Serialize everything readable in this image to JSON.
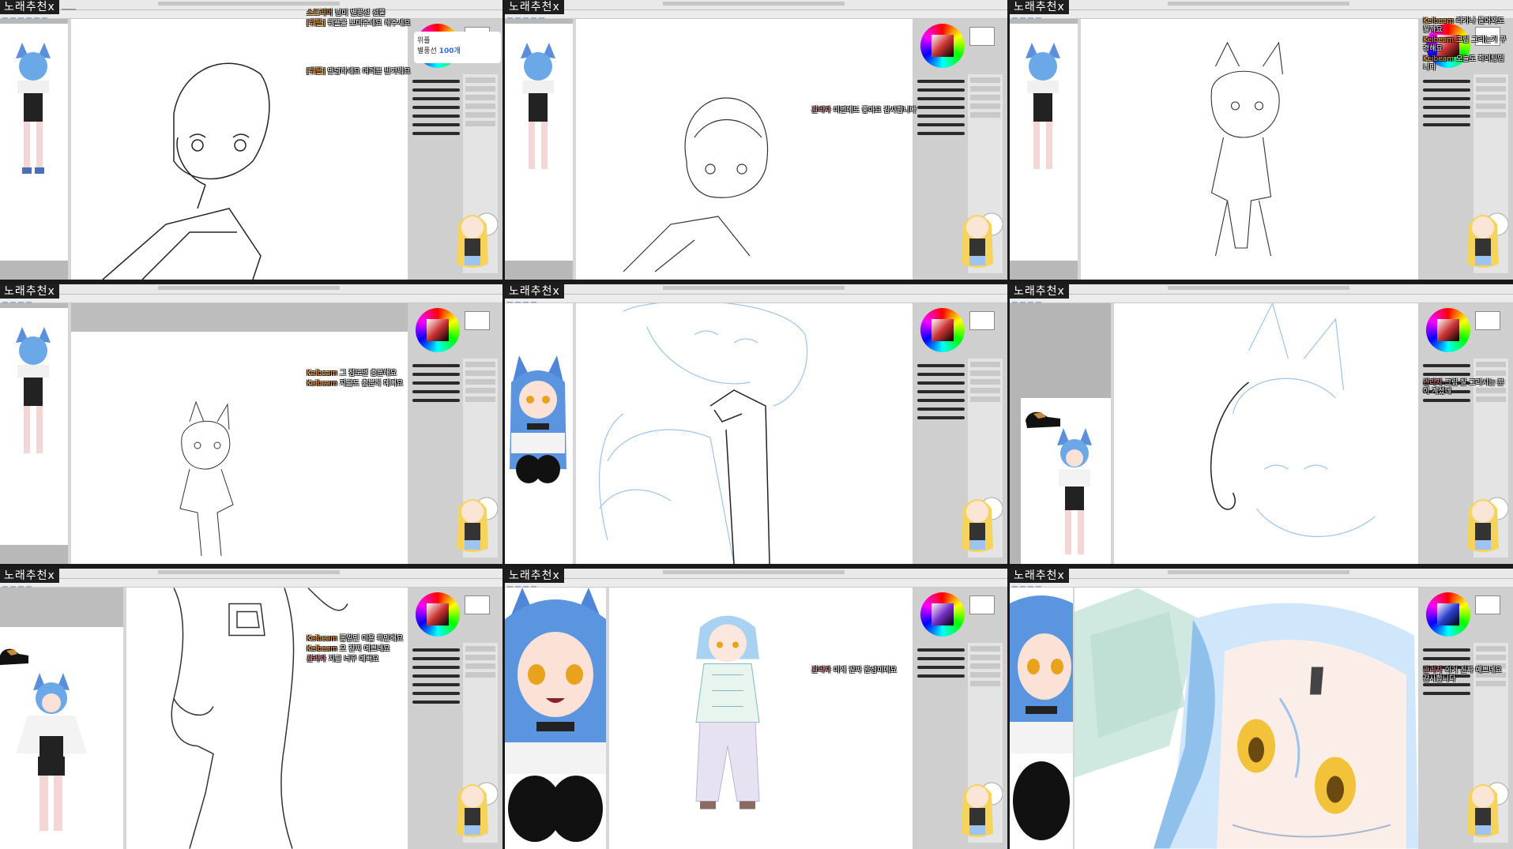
{
  "stream_badge": "노래추천x",
  "panels": [
    {
      "id": "p1",
      "chat": [
        {
          "nick": "스트리머",
          "text": "님이 별풍선 선물"
        },
        {
          "nick": "[위플]",
          "text": "위플을 보여주세요 해주세요"
        },
        {
          "nick": "[위플]",
          "text": "안녕하세요 여러분 반가워요"
        }
      ],
      "popup": {
        "user": "위플",
        "text": "별풍선",
        "count": "100개"
      }
    },
    {
      "id": "p2",
      "chat": [
        {
          "nick": "관리자",
          "text": "이번에도 좋아요 감사합니다"
        }
      ]
    },
    {
      "id": "p3",
      "chat": [
        {
          "nick": "Keibeam",
          "text": "라가나 들어와도 될까요"
        },
        {
          "nick": "Keibeam",
          "text": "그림 그리는거 구경해요"
        },
        {
          "nick": "Keibeam",
          "text": "오늘도 화이팅입니다"
        }
      ]
    },
    {
      "id": "p4",
      "chat": [
        {
          "nick": "Keibeam",
          "text": "그 정도면 충분해요"
        },
        {
          "nick": "Keibeam",
          "text": "지금도 충분히 예뻐요"
        }
      ]
    },
    {
      "id": "p5",
      "chat": []
    },
    {
      "id": "p6",
      "chat": [
        {
          "nick": "관리자",
          "text": "그림 잘 그리시는 분이 계셨네"
        }
      ]
    },
    {
      "id": "p7",
      "chat": [
        {
          "nick": "Keibeam",
          "text": "동일인 이용 확인해요"
        },
        {
          "nick": "Keibeam",
          "text": "오 진짜 예쁘네요"
        },
        {
          "nick": "관리자",
          "text": "지금 너무 예뻐요"
        }
      ]
    },
    {
      "id": "p8",
      "chat": [
        {
          "nick": "관리자",
          "text": "이게 진짜 완성이에요"
        }
      ]
    },
    {
      "id": "p9",
      "chat": [
        {
          "nick": "관리자",
          "text": "이거 진짜 예쁘네요 감사합니다"
        }
      ]
    }
  ],
  "colors": {
    "canvas": "#ffffff",
    "ui": "#d6d6d6",
    "badge_bg": "#1e1e1e",
    "sketch_blue": "#9cc4ee",
    "hair_blue": "#6aa8e8"
  }
}
